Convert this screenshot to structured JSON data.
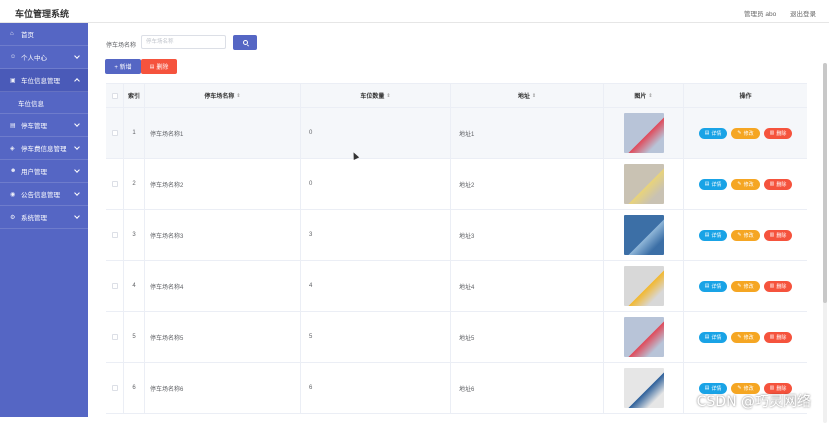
{
  "app": {
    "title": "车位管理系统"
  },
  "topbar": {
    "user_label": "管理员 abo",
    "logout_label": "退出登录"
  },
  "sidebar": {
    "items": [
      {
        "label": "首页",
        "icon": "home-icon",
        "expandable": false
      },
      {
        "label": "个人中心",
        "icon": "user-icon",
        "expandable": true
      },
      {
        "label": "车位信息管理",
        "icon": "parking-icon",
        "expandable": true,
        "expanded": true,
        "children": [
          "车位信息"
        ]
      },
      {
        "label": "停车管理",
        "icon": "car-icon",
        "expandable": true
      },
      {
        "label": "停车费信息管理",
        "icon": "money-icon",
        "expandable": true
      },
      {
        "label": "用户管理",
        "icon": "users-icon",
        "expandable": true
      },
      {
        "label": "公告信息管理",
        "icon": "notice-icon",
        "expandable": true
      },
      {
        "label": "系统管理",
        "icon": "settings-icon",
        "expandable": true
      }
    ]
  },
  "search": {
    "label": "停车场名称",
    "placeholder": "停车场名称",
    "value": ""
  },
  "toolbar": {
    "add_label": "+ 新增",
    "delete_label": "删除"
  },
  "table": {
    "headers": {
      "index": "索引",
      "name": "停车场名称",
      "count": "车位数量",
      "address": "地址",
      "image": "图片",
      "ops": "操作"
    },
    "ops_labels": {
      "detail": "详情",
      "edit": "修改",
      "delete": "删除"
    },
    "rows": [
      {
        "index": "1",
        "name": "停车场名称1",
        "count": "0",
        "address": "地址1",
        "image_colors": [
          "#b8c4d8",
          "#e04a5a"
        ]
      },
      {
        "index": "2",
        "name": "停车场名称2",
        "count": "0",
        "address": "地址2",
        "image_colors": [
          "#c9c2b3",
          "#e8d37a"
        ]
      },
      {
        "index": "3",
        "name": "停车场名称3",
        "count": "3",
        "address": "地址3",
        "image_colors": [
          "#3c6fa6",
          "#8fb6d8"
        ]
      },
      {
        "index": "4",
        "name": "停车场名称4",
        "count": "4",
        "address": "地址4",
        "image_colors": [
          "#d8d8d8",
          "#f2b830"
        ]
      },
      {
        "index": "5",
        "name": "停车场名称5",
        "count": "5",
        "address": "地址5",
        "image_colors": [
          "#b8c4d8",
          "#e04a5a"
        ]
      },
      {
        "index": "6",
        "name": "停车场名称6",
        "count": "6",
        "address": "地址6",
        "image_colors": [
          "#e6e6e6",
          "#2d5f9a"
        ]
      }
    ]
  },
  "watermark": "CSDN @巧灵网络",
  "colors": {
    "primary": "#5566c4",
    "danger": "#f5533d",
    "info": "#19a3e6",
    "warning": "#f5a623"
  }
}
